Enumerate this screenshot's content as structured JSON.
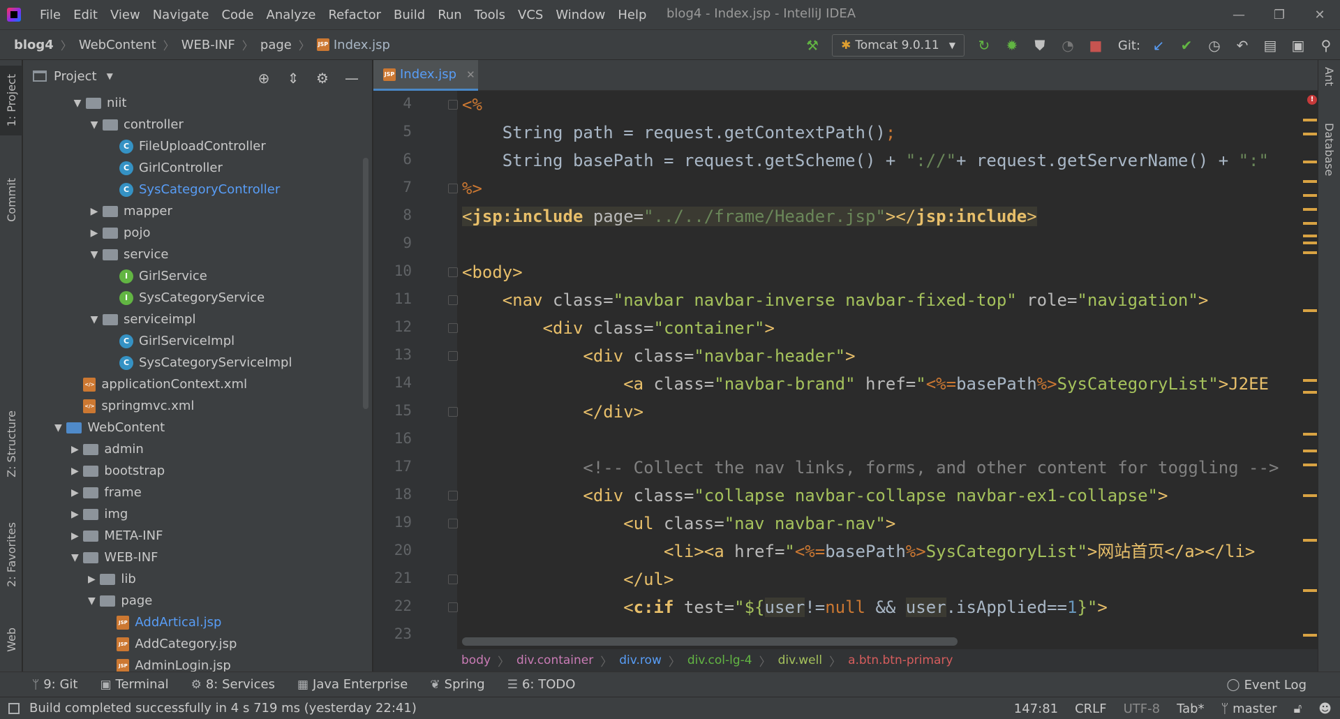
{
  "window": {
    "title": "blog4 - Index.jsp - IntelliJ IDEA",
    "controls": [
      "—",
      "❐",
      "✕"
    ]
  },
  "menu": [
    "File",
    "Edit",
    "View",
    "Navigate",
    "Code",
    "Analyze",
    "Refactor",
    "Build",
    "Run",
    "Tools",
    "VCS",
    "Window",
    "Help"
  ],
  "breadcrumb": [
    "blog4",
    "WebContent",
    "WEB-INF",
    "page",
    "Index.jsp"
  ],
  "toolbar": {
    "run_config": "Tomcat 9.0.11",
    "git_label": "Git:"
  },
  "left_stripe": {
    "project": "1: Project",
    "commit": "Commit",
    "structure": "Z: Structure",
    "favorites": "2: Favorites",
    "web": "Web"
  },
  "right_stripe": {
    "ant": "Ant",
    "database": "Database"
  },
  "project_panel": {
    "title": "Project",
    "tree": [
      {
        "label": "niit",
        "icon": "pkg",
        "arrow": "▼",
        "level": 2
      },
      {
        "label": "controller",
        "icon": "pkg",
        "arrow": "▼",
        "level": 3
      },
      {
        "label": "FileUploadController",
        "icon": "c",
        "arrow": "",
        "level": 4
      },
      {
        "label": "GirlController",
        "icon": "c",
        "arrow": "",
        "level": 4
      },
      {
        "label": "SysCategoryController",
        "icon": "c",
        "arrow": "",
        "level": 4,
        "highlight": true
      },
      {
        "label": "mapper",
        "icon": "pkg",
        "arrow": "▶",
        "level": 3
      },
      {
        "label": "pojo",
        "icon": "pkg",
        "arrow": "▶",
        "level": 3
      },
      {
        "label": "service",
        "icon": "pkg",
        "arrow": "▼",
        "level": 3
      },
      {
        "label": "GirlService",
        "icon": "i",
        "arrow": "",
        "level": 4
      },
      {
        "label": "SysCategoryService",
        "icon": "i",
        "arrow": "",
        "level": 4
      },
      {
        "label": "serviceimpl",
        "icon": "pkg",
        "arrow": "▼",
        "level": 3
      },
      {
        "label": "GirlServiceImpl",
        "icon": "c",
        "arrow": "",
        "level": 4
      },
      {
        "label": "SysCategoryServiceImpl",
        "icon": "c",
        "arrow": "",
        "level": 4
      },
      {
        "label": "applicationContext.xml",
        "icon": "xml",
        "arrow": "",
        "level": 1.85
      },
      {
        "label": "springmvc.xml",
        "icon": "xml",
        "arrow": "",
        "level": 1.85
      },
      {
        "label": "WebContent",
        "icon": "web",
        "arrow": "▼",
        "level": 0.85
      },
      {
        "label": "admin",
        "icon": "folder",
        "arrow": "▶",
        "level": 1.85
      },
      {
        "label": "bootstrap",
        "icon": "folder",
        "arrow": "▶",
        "level": 1.85
      },
      {
        "label": "frame",
        "icon": "folder",
        "arrow": "▶",
        "level": 1.85
      },
      {
        "label": "img",
        "icon": "folder",
        "arrow": "▶",
        "level": 1.85
      },
      {
        "label": "META-INF",
        "icon": "folder",
        "arrow": "▶",
        "level": 1.85
      },
      {
        "label": "WEB-INF",
        "icon": "folder",
        "arrow": "▼",
        "level": 1.85
      },
      {
        "label": "lib",
        "icon": "folder",
        "arrow": "▶",
        "level": 2.85
      },
      {
        "label": "page",
        "icon": "folder",
        "arrow": "▼",
        "level": 2.85
      },
      {
        "label": "AddArtical.jsp",
        "icon": "jsp",
        "arrow": "",
        "level": 3.85,
        "highlight": true
      },
      {
        "label": "AddCategory.jsp",
        "icon": "jsp",
        "arrow": "",
        "level": 3.85
      },
      {
        "label": "AdminLogin.jsp",
        "icon": "jsp",
        "arrow": "",
        "level": 3.85
      }
    ]
  },
  "editor": {
    "tab": "Index.jsp",
    "line_numbers": [
      "4",
      "5",
      "6",
      "7",
      "8",
      "9",
      "10",
      "11",
      "12",
      "13",
      "14",
      "15",
      "16",
      "17",
      "18",
      "19",
      "20",
      "21",
      "22",
      "23"
    ],
    "lines": {
      "l4": "<%",
      "l5a": "    String path = request.getContextPath()",
      "l5b": ";",
      "l6a": "    String basePath = request.getScheme() + ",
      "l6b": "\"://\"",
      "l6c": "+ request.getServerName() + ",
      "l6d": "\":\"",
      "l7": "%>",
      "l8a": "<",
      "l8b": "jsp:include",
      "l8c": " page=",
      "l8d": "\"../../frame/Header.jsp\"",
      "l8e": "></",
      "l8f": "jsp:include",
      "l8g": ">",
      "l10": "<body>",
      "l11a": "    <nav ",
      "l11b": "class=",
      "l11c": "\"navbar navbar-inverse navbar-fixed-top\"",
      "l11d": " role=",
      "l11e": "\"navigation\"",
      "l11f": ">",
      "l12a": "        <div ",
      "l12b": "class=",
      "l12c": "\"container\"",
      "l12d": ">",
      "l13a": "            <div ",
      "l13b": "class=",
      "l13c": "\"navbar-header\"",
      "l13d": ">",
      "l14a": "                <a ",
      "l14b": "class=",
      "l14c": "\"navbar-brand\"",
      "l14d": " href=",
      "l14e": "\"",
      "l14f": "<%=",
      "l14g": "basePath",
      "l14h": "%>",
      "l14i": "SysCategoryList\"",
      "l14j": ">J2EE",
      "l15": "            </div>",
      "l17": "            <!-- Collect the nav links, forms, and other content for toggling -->",
      "l18a": "            <div ",
      "l18b": "class=",
      "l18c": "\"collapse navbar-collapse navbar-ex1-collapse\"",
      "l18d": ">",
      "l19a": "                <ul ",
      "l19b": "class=",
      "l19c": "\"nav navbar-nav\"",
      "l19d": ">",
      "l20a": "                    <li><a ",
      "l20b": "href=",
      "l20c": "\"",
      "l20d": "<%=",
      "l20e": "basePath",
      "l20f": "%>",
      "l20g": "SysCategoryList\"",
      "l20h": ">网站首页</a></li>",
      "l21": "                </ul>",
      "l22a": "                <",
      "l22b": "c:if",
      "l22c": " test=",
      "l22d": "\"${",
      "l22e": "user",
      "l22f": "!=",
      "l22g": "null",
      "l22h": " && ",
      "l22i": "user",
      "l22j": ".isApplied==",
      "l22k": "1",
      "l22l": "}\"",
      "l22m": ">"
    }
  },
  "editor_breadcrumb": [
    "body",
    "div.container",
    "div.row",
    "div.col-lg-4",
    "div.well",
    "a.btn.btn-primary"
  ],
  "bottom_tabs": {
    "git": "9: Git",
    "terminal": "Terminal",
    "services": "8: Services",
    "java_enterprise": "Java Enterprise",
    "spring": "Spring",
    "todo": "6: TODO",
    "event_log": "Event Log"
  },
  "status": {
    "message": "Build completed successfully in 4 s 719 ms (yesterday 22:41)",
    "position": "147:81",
    "line_sep": "CRLF",
    "encoding": "UTF-8",
    "indent": "Tab*",
    "branch": "master"
  },
  "colors": {
    "accent": "#4a88c7",
    "tag": "#e8bf6a",
    "string": "#a5c25c",
    "jsp": "#cc7832",
    "comment": "#808080"
  }
}
